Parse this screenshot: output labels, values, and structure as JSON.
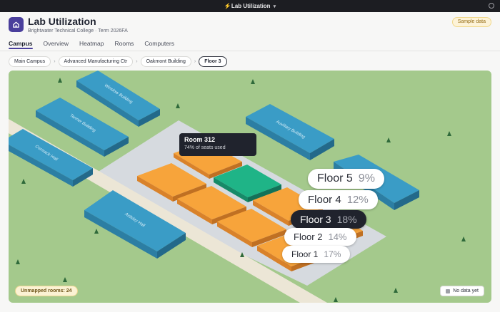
{
  "window": {
    "title": "Lab Utilization"
  },
  "header": {
    "title": "Lab Utilization",
    "subtitle": "Brightwater Technical College · Term 2026FA",
    "badge": "Sample data",
    "accent": "#4a3f9c"
  },
  "tabs": [
    {
      "label": "Campus",
      "active": true
    },
    {
      "label": "Overview",
      "active": false
    },
    {
      "label": "Heatmap",
      "active": false
    },
    {
      "label": "Rooms",
      "active": false
    },
    {
      "label": "Computers",
      "active": false
    }
  ],
  "breadcrumb": [
    "Main Campus",
    "Advanced Manufacturing Ctr",
    "Oakmont Building",
    "Floor 3"
  ],
  "map": {
    "buildings": [
      {
        "name": "Winslow Building"
      },
      {
        "name": "Tanner Building"
      },
      {
        "name": "Cormack Hall"
      },
      {
        "name": "Ardsley Hall"
      },
      {
        "name": "Auxiliary Building"
      }
    ],
    "tooltip": {
      "room": "Room 312",
      "detail": "74% of seats used"
    },
    "floors": [
      {
        "label": "Floor 5",
        "pct": "9%"
      },
      {
        "label": "Floor 4",
        "pct": "12%"
      },
      {
        "label": "Floor 3",
        "pct": "18%",
        "active": true
      },
      {
        "label": "Floor 2",
        "pct": "14%"
      },
      {
        "label": "Floor 1",
        "pct": "17%"
      }
    ],
    "colors": {
      "grass": "#a4c98c",
      "building": "#3a9cc6",
      "room": "#f7a43b",
      "room_selected": "#1fb487",
      "floor_plate": "#d6dadf",
      "road": "#ece6d6"
    }
  },
  "unmapped": "Unmapped rooms: 24",
  "legend": {
    "nodata": "No data yet"
  }
}
